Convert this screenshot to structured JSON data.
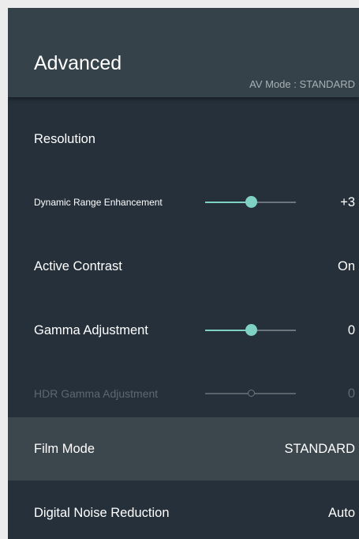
{
  "header": {
    "title": "Advanced",
    "av_mode": "AV Mode : STANDARD"
  },
  "items": [
    {
      "label": "Resolution",
      "value": ""
    },
    {
      "label": "Dynamic Range Enhancement",
      "value": "+3",
      "slider_fraction": 0.5
    },
    {
      "label": "Active Contrast",
      "value": "On"
    },
    {
      "label": "Gamma Adjustment",
      "value": "0",
      "slider_fraction": 0.5
    },
    {
      "label": "HDR Gamma Adjustment",
      "value": "0",
      "slider_fraction": 0.5,
      "disabled": true
    },
    {
      "label": "Film Mode",
      "value": "STANDARD",
      "selected": true
    },
    {
      "label": "Digital Noise Reduction",
      "value": "Auto"
    }
  ],
  "colors": {
    "accent": "#7fd1c3",
    "panel_background": "#25303a",
    "header_background": "#35424a",
    "selected_row": "#3b464d"
  }
}
